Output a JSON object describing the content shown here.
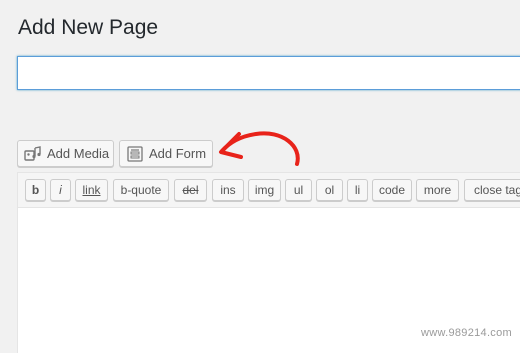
{
  "page": {
    "title": "Add New Page",
    "title_input_value": "",
    "title_input_placeholder": ""
  },
  "media_buttons": {
    "add_media": {
      "label": "Add Media",
      "icon": "media-icon"
    },
    "add_form": {
      "label": "Add Form",
      "icon": "form-icon"
    }
  },
  "toolbar": {
    "buttons": [
      "b",
      "i",
      "link",
      "b-quote",
      "del",
      "ins",
      "img",
      "ul",
      "ol",
      "li",
      "code",
      "more",
      "close tags"
    ]
  },
  "annotation": {
    "arrow_color": "#e8231a"
  },
  "watermark": "www.989214.com",
  "colors": {
    "accent": "#5b9dd9",
    "arrow": "#e8231a"
  }
}
